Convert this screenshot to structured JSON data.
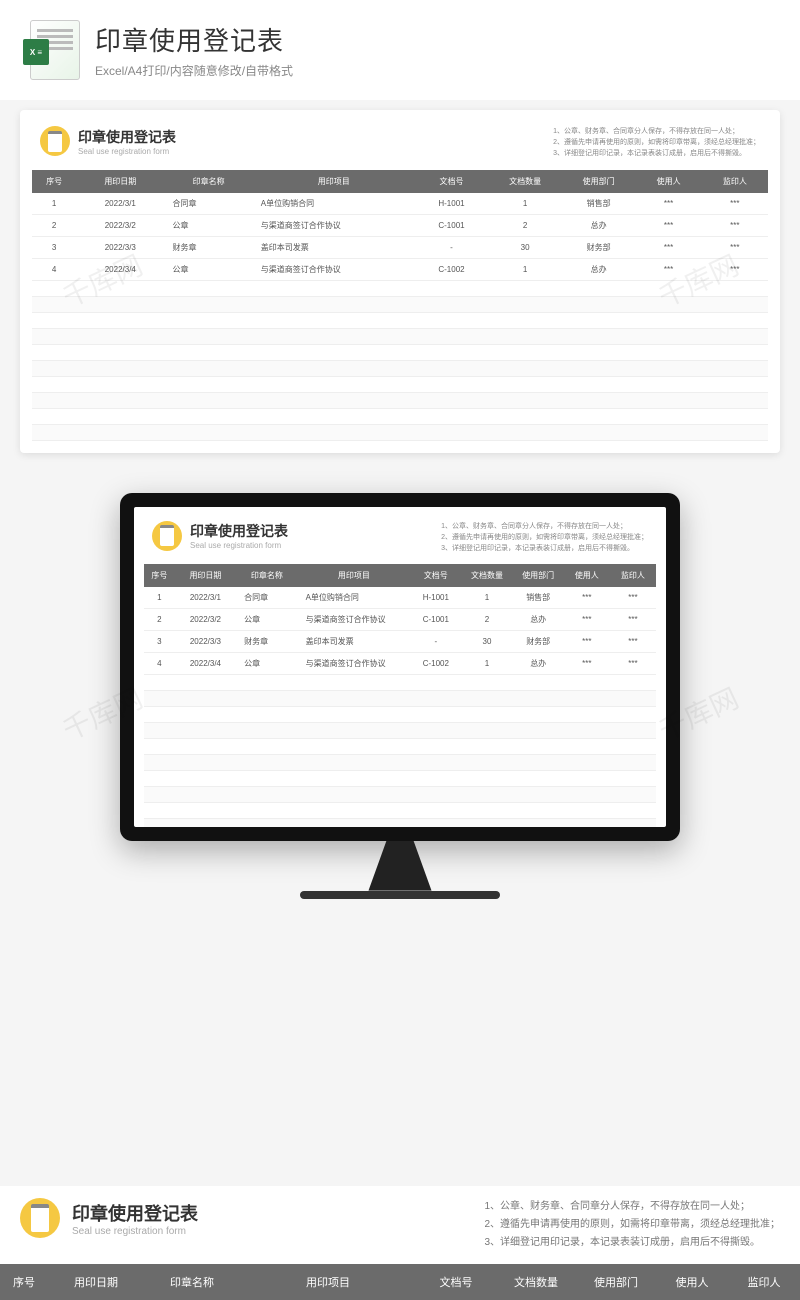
{
  "banner": {
    "title": "印章使用登记表",
    "subtitle": "Excel/A4打印/内容随意修改/自带格式",
    "badge": "X ≡"
  },
  "doc": {
    "title": "印章使用登记表",
    "subtitle": "Seal use registration form",
    "notes": [
      "1、公章、财务章、合同章分人保存，不得存放在同一人处；",
      "2、遵循先申请再使用的原则，如需将印章带离，须经总经理批准；",
      "3、详细登记用印记录，本记录表装订成册，启用后不得撕毁。"
    ]
  },
  "columns": [
    "序号",
    "用印日期",
    "印章名称",
    "用印项目",
    "文档号",
    "文档数量",
    "使用部门",
    "使用人",
    "监印人"
  ],
  "rows": [
    {
      "n": "1",
      "date": "2022/3/1",
      "seal": "合同章",
      "item": "A单位购销合同",
      "doc": "H-1001",
      "qty": "1",
      "dept": "销售部",
      "user": "***",
      "sup": "***"
    },
    {
      "n": "2",
      "date": "2022/3/2",
      "seal": "公章",
      "item": "与渠道商签订合作协议",
      "doc": "C-1001",
      "qty": "2",
      "dept": "总办",
      "user": "***",
      "sup": "***"
    },
    {
      "n": "3",
      "date": "2022/3/3",
      "seal": "财务章",
      "item": "盖印本司发票",
      "doc": "-",
      "qty": "30",
      "dept": "财务部",
      "user": "***",
      "sup": "***"
    },
    {
      "n": "4",
      "date": "2022/3/4",
      "seal": "公章",
      "item": "与渠道商签订合作协议",
      "doc": "C-1002",
      "qty": "1",
      "dept": "总办",
      "user": "***",
      "sup": "***"
    }
  ],
  "watermark": "千库网"
}
